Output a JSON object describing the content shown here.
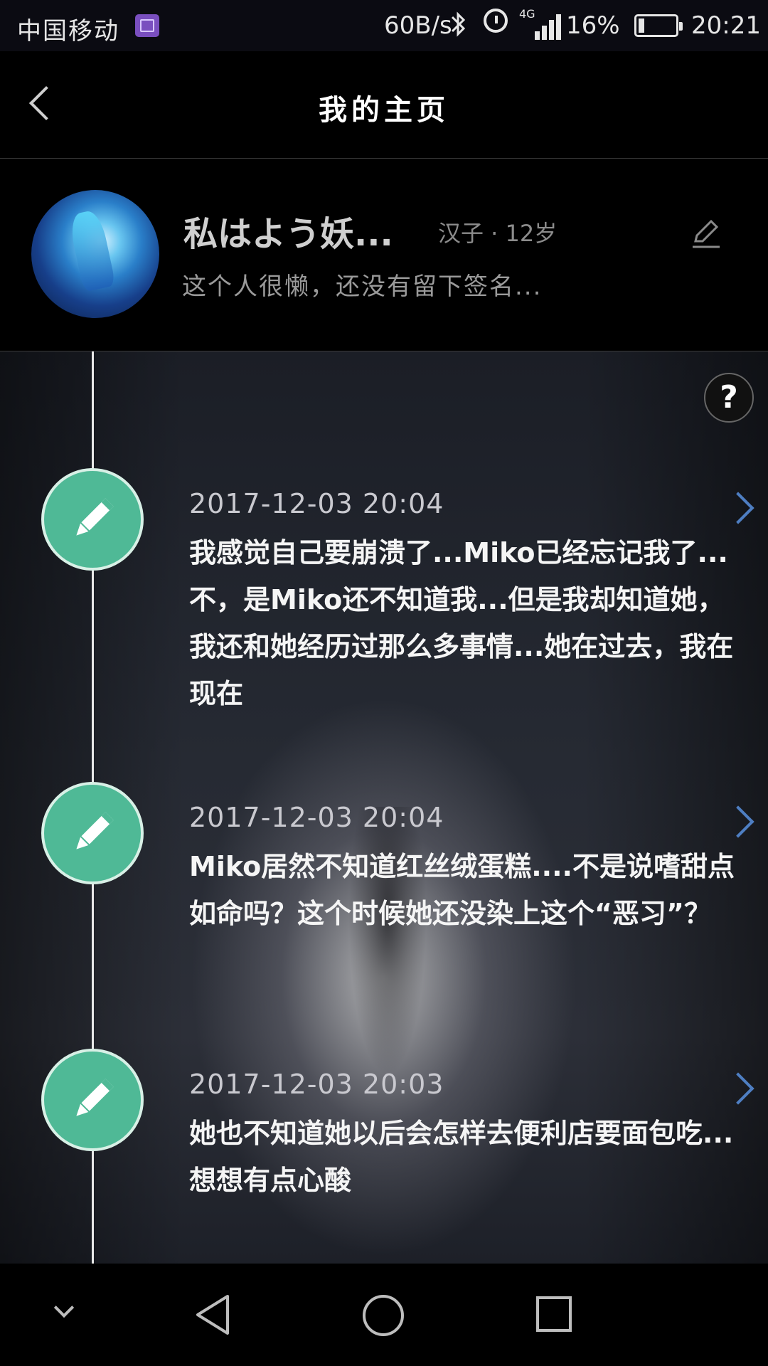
{
  "status_bar": {
    "carrier": "中国移动",
    "speed": "60B/s",
    "network": "4G",
    "battery": "16%",
    "time": "20:21"
  },
  "header": {
    "title": "我的主页"
  },
  "profile": {
    "nickname": "私はよう妖...",
    "gender_age": "汉子 · 12岁",
    "signature": "这个人很懒，还没有留下签名..."
  },
  "help_label": "?",
  "entries": [
    {
      "date": "2017-12-03 20:04",
      "text": "我感觉自己要崩溃了...Miko已经忘记我了...不，是Miko还不知道我...但是我却知道她，我还和她经历过那么多事情...她在过去，我在现在"
    },
    {
      "date": "2017-12-03 20:04",
      "text": "Miko居然不知道红丝绒蛋糕....不是说嗜甜点如命吗？这个时候她还没染上这个“恶习”？"
    },
    {
      "date": "2017-12-03 20:03",
      "text": "她也不知道她以后会怎样去便利店要面包吃...想想有点心酸"
    }
  ],
  "colors": {
    "node": "#4fb996",
    "arrow": "#4e7ec2"
  }
}
